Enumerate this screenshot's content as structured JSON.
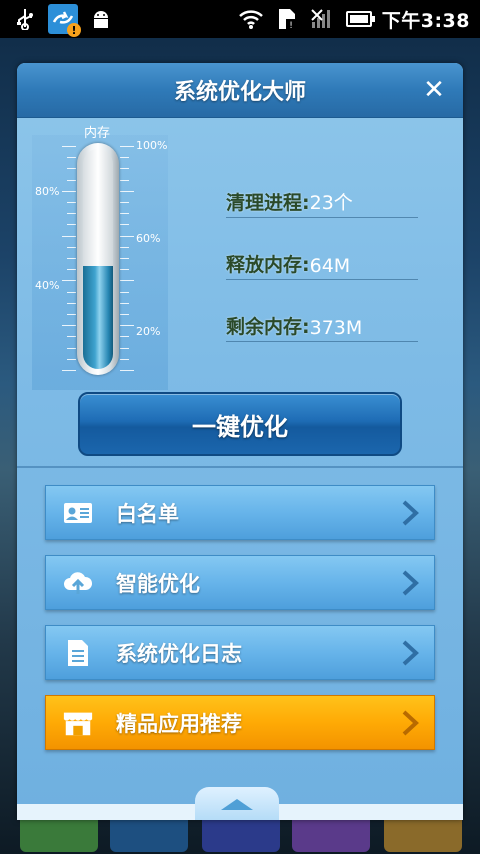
{
  "status_bar": {
    "time": "下午3:38",
    "icons": [
      "usb-icon",
      "sync-notification-icon",
      "android-debug-icon",
      "wifi-icon",
      "sd-card-icon",
      "no-signal-icon",
      "battery-icon"
    ]
  },
  "dialog": {
    "title": "系统优化大师",
    "close_icon": "close-icon"
  },
  "memory_gauge": {
    "label": "内存",
    "scale_labels": [
      "100%",
      "80%",
      "60%",
      "40%",
      "20%"
    ],
    "fill_fraction": 0.47
  },
  "stats": [
    {
      "label": "清理进程:",
      "value": "23个"
    },
    {
      "label": "释放内存:",
      "value": "64M"
    },
    {
      "label": "剩余内存:",
      "value": "373M"
    }
  ],
  "optimize_button": "一键优化",
  "menu": [
    {
      "label": "白名单",
      "icon": "id-card-icon"
    },
    {
      "label": "智能优化",
      "icon": "cloud-upload-icon"
    },
    {
      "label": "系统优化日志",
      "icon": "document-icon"
    },
    {
      "label": "精品应用推荐",
      "icon": "store-icon"
    }
  ],
  "colors": {
    "accent_blue": "#2f7ab8",
    "featured_orange": "#ffaa05"
  }
}
